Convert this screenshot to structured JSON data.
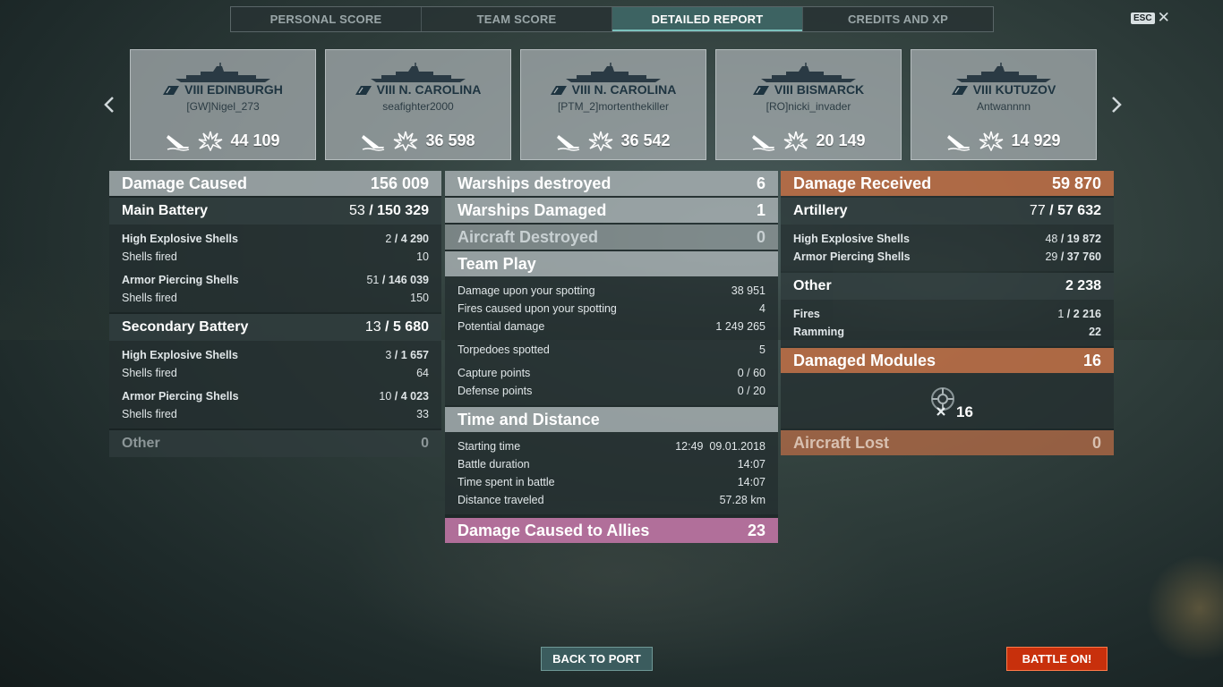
{
  "tabs": [
    {
      "label": "PERSONAL SCORE"
    },
    {
      "label": "TEAM SCORE"
    },
    {
      "label": "DETAILED REPORT"
    },
    {
      "label": "CREDITS AND XP"
    }
  ],
  "esc": {
    "key": "ESC",
    "close": "✕"
  },
  "ships": [
    {
      "name": "VIII EDINBURGH",
      "player": "[GW]Nigel_273",
      "damage": "44 109"
    },
    {
      "name": "VIII N. CAROLINA",
      "player": "seafighter2000",
      "damage": "36 598"
    },
    {
      "name": "VIII N. CAROLINA",
      "player": "[PTM_2]mortenthekiller",
      "damage": "36 542"
    },
    {
      "name": "VIII BISMARCK",
      "player": "[RO]nicki_invader",
      "damage": "20 149"
    },
    {
      "name": "VIII KUTUZOV",
      "player": "Antwannnn",
      "damage": "14 929"
    }
  ],
  "left": {
    "damage_caused": {
      "label": "Damage Caused",
      "value": "156 009"
    },
    "main_battery": {
      "label": "Main Battery",
      "hits": "53",
      "value": "150 329"
    },
    "mb_he": {
      "label": "High Explosive Shells",
      "hits": "2",
      "value": "4 290"
    },
    "mb_he_fired": {
      "label": "Shells fired",
      "value": "10"
    },
    "mb_ap": {
      "label": "Armor Piercing Shells",
      "hits": "51",
      "value": "146 039"
    },
    "mb_ap_fired": {
      "label": "Shells fired",
      "value": "150"
    },
    "secondary": {
      "label": "Secondary Battery",
      "hits": "13",
      "value": "5 680"
    },
    "sb_he": {
      "label": "High Explosive Shells",
      "hits": "3",
      "value": "1 657"
    },
    "sb_he_fired": {
      "label": "Shells fired",
      "value": "64"
    },
    "sb_ap": {
      "label": "Armor Piercing Shells",
      "hits": "10",
      "value": "4 023"
    },
    "sb_ap_fired": {
      "label": "Shells fired",
      "value": "33"
    },
    "other": {
      "label": "Other",
      "value": "0"
    }
  },
  "middle": {
    "warships_destroyed": {
      "label": "Warships destroyed",
      "value": "6"
    },
    "warships_damaged": {
      "label": "Warships Damaged",
      "value": "1"
    },
    "aircraft_destroyed": {
      "label": "Aircraft Destroyed",
      "value": "0"
    },
    "team_play": {
      "label": "Team Play"
    },
    "spot_damage": {
      "label": "Damage upon your spotting",
      "value": "38 951"
    },
    "spot_fires": {
      "label": "Fires caused upon your spotting",
      "value": "4"
    },
    "potential": {
      "label": "Potential damage",
      "value": "1 249 265"
    },
    "torpedoes": {
      "label": "Torpedoes spotted",
      "value": "5"
    },
    "capture": {
      "label": "Capture points",
      "value": "0 / 60"
    },
    "defense": {
      "label": "Defense points",
      "value": "0 / 20"
    },
    "time_distance": {
      "label": "Time and Distance"
    },
    "start": {
      "label": "Starting time",
      "value": "12:49  09.01.2018"
    },
    "duration": {
      "label": "Battle duration",
      "value": "14:07"
    },
    "time_spent": {
      "label": "Time spent in battle",
      "value": "14:07"
    },
    "distance": {
      "label": "Distance traveled",
      "value": "57.28 km"
    },
    "allies": {
      "label": "Damage Caused to Allies",
      "value": "23"
    }
  },
  "right": {
    "damage_received": {
      "label": "Damage Received",
      "value": "59 870"
    },
    "artillery": {
      "label": "Artillery",
      "hits": "77",
      "value": "57 632"
    },
    "art_he": {
      "label": "High Explosive Shells",
      "hits": "48",
      "value": "19 872"
    },
    "art_ap": {
      "label": "Armor Piercing Shells",
      "hits": "29",
      "value": "37 760"
    },
    "other": {
      "label": "Other",
      "value": "2 238"
    },
    "fires": {
      "label": "Fires",
      "hits": "1",
      "value": "2 216"
    },
    "ramming": {
      "label": "Ramming",
      "value": "22"
    },
    "modules": {
      "label": "Damaged Modules",
      "value": "16",
      "icon_value": "16"
    },
    "aircraft_lost": {
      "label": "Aircraft Lost",
      "value": "0"
    }
  },
  "buttons": {
    "back": "BACK TO PORT",
    "battle": "BATTLE ON!"
  },
  "icons": {
    "flag": "ship-class-flag-icon",
    "sunk": "sunk-ship-icon",
    "damage": "explosion-icon",
    "module": "damaged-module-icon"
  },
  "colors": {
    "accent_teal": "#7cc2bd",
    "received_orange": "#be6e46",
    "allies_pink": "#c878aa",
    "battle_red": "#c8300c"
  }
}
